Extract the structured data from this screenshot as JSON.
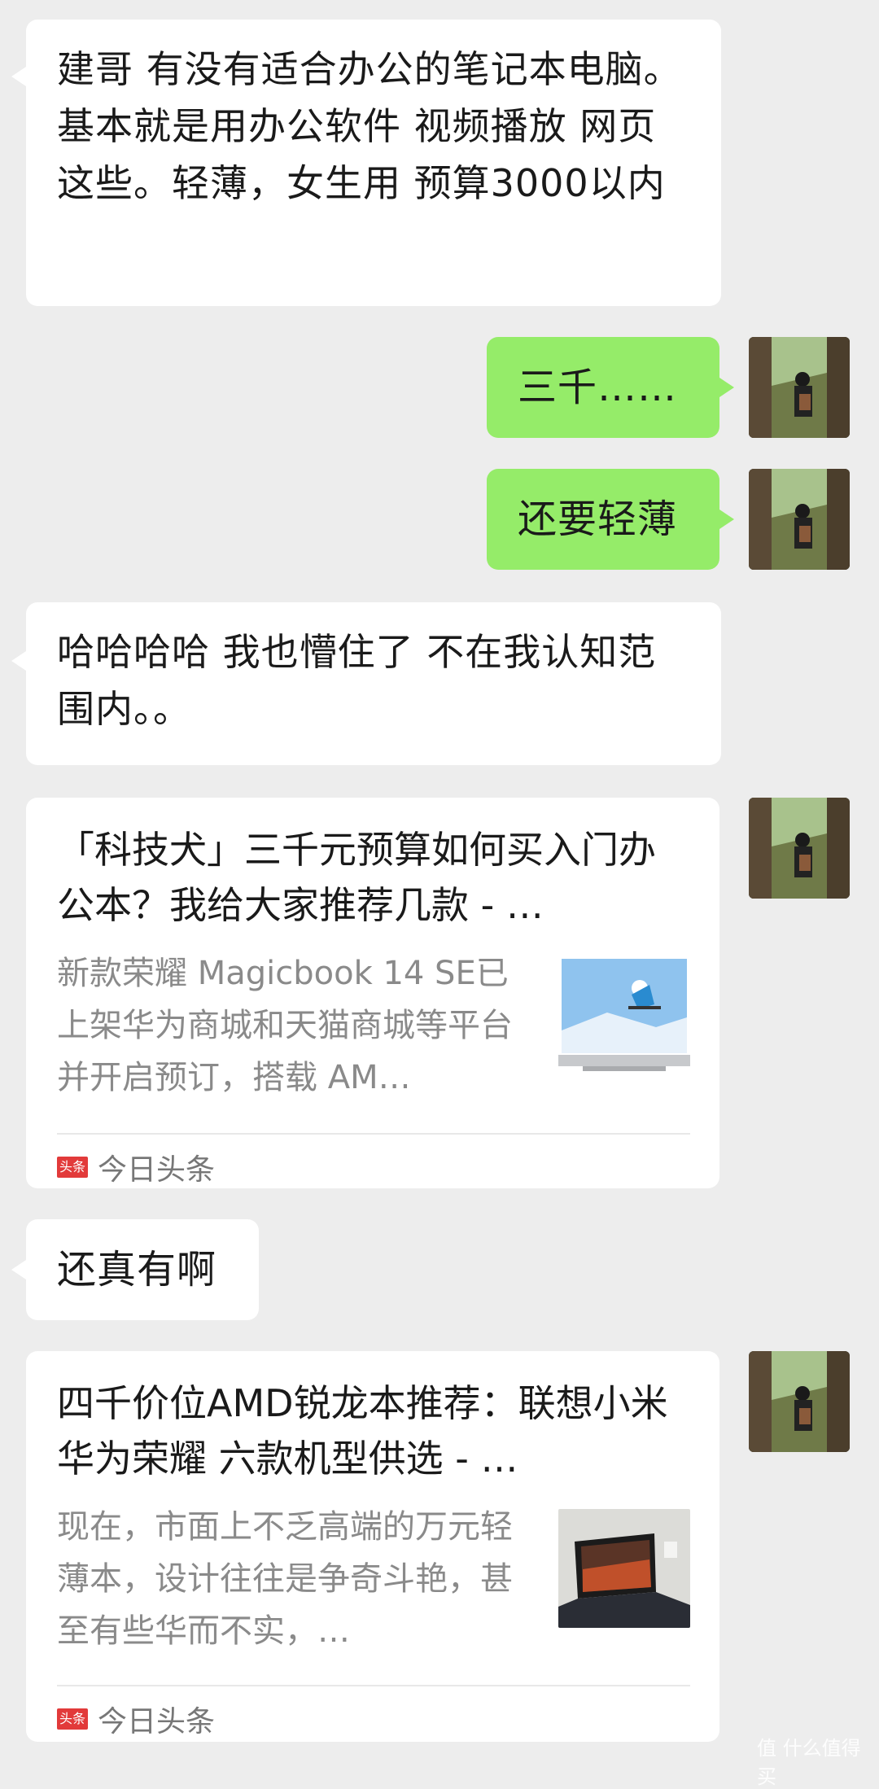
{
  "conversation": {
    "messages": [
      {
        "text": "建哥  有没有适合办公的笔记本电脑。基本就是用办公软件 视频播放  网页这些。轻薄，女生用 预算3000以内"
      },
      {
        "text": "三千……"
      },
      {
        "text": "还要轻薄"
      },
      {
        "text": "哈哈哈哈 我也懵住了  不在我认知范围内。。"
      },
      {
        "title": "「科技犬」三千元预算如何买入门办公本？我给大家推荐几款 - …",
        "description": "新款荣耀 Magicbook 14 SE已上架华为商城和天猫商城等平台并开启预订，搭载 AM…",
        "source": "今日头条",
        "source_badge": "头条"
      },
      {
        "text": "还真有啊"
      },
      {
        "title": "四千价位AMD锐龙本推荐：联想小米华为荣耀 六款机型供选 - …",
        "description": "现在，市面上不乏高端的万元轻薄本，设计往往是争奇斗艳，甚至有些华而不实，…",
        "source": "今日头条",
        "source_badge": "头条"
      }
    ]
  },
  "watermark": "值 什么值得买",
  "colors": {
    "background": "#ededed",
    "incoming_bubble": "#ffffff",
    "outgoing_bubble": "#95ec69",
    "source_badge": "#e23a3a"
  }
}
